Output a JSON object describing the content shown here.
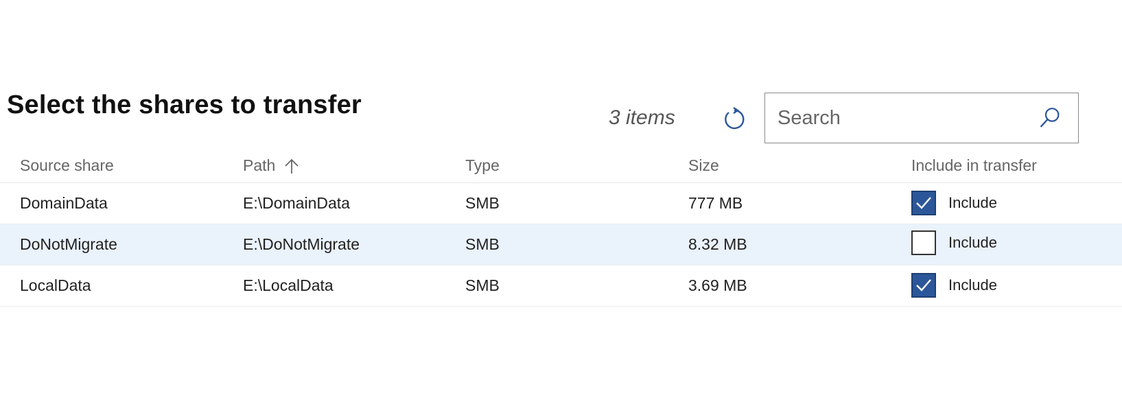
{
  "header": {
    "title": "Select the shares to transfer",
    "item_count": "3 items",
    "refresh_icon": "refresh-icon",
    "search": {
      "placeholder": "Search",
      "value": "",
      "icon": "search-icon"
    }
  },
  "table": {
    "columns": {
      "source_share": "Source share",
      "path": "Path",
      "type": "Type",
      "size": "Size",
      "include": "Include in transfer"
    },
    "sort": {
      "column": "Path",
      "direction": "ascending",
      "icon": "arrow-up-icon"
    },
    "rows": [
      {
        "source_share": "DomainData",
        "path": "E:\\DomainData",
        "type": "SMB",
        "size": "777 MB",
        "include_label": "Include",
        "included": true,
        "selected": false
      },
      {
        "source_share": "DoNotMigrate",
        "path": "E:\\DoNotMigrate",
        "type": "SMB",
        "size": "8.32 MB",
        "include_label": "Include",
        "included": false,
        "selected": true
      },
      {
        "source_share": "LocalData",
        "path": "E:\\LocalData",
        "type": "SMB",
        "size": "3.69 MB",
        "include_label": "Include",
        "included": true,
        "selected": false
      }
    ]
  },
  "colors": {
    "accent": "#2b579a",
    "row_selected": "#eaf2fc",
    "header_text": "#666666"
  }
}
